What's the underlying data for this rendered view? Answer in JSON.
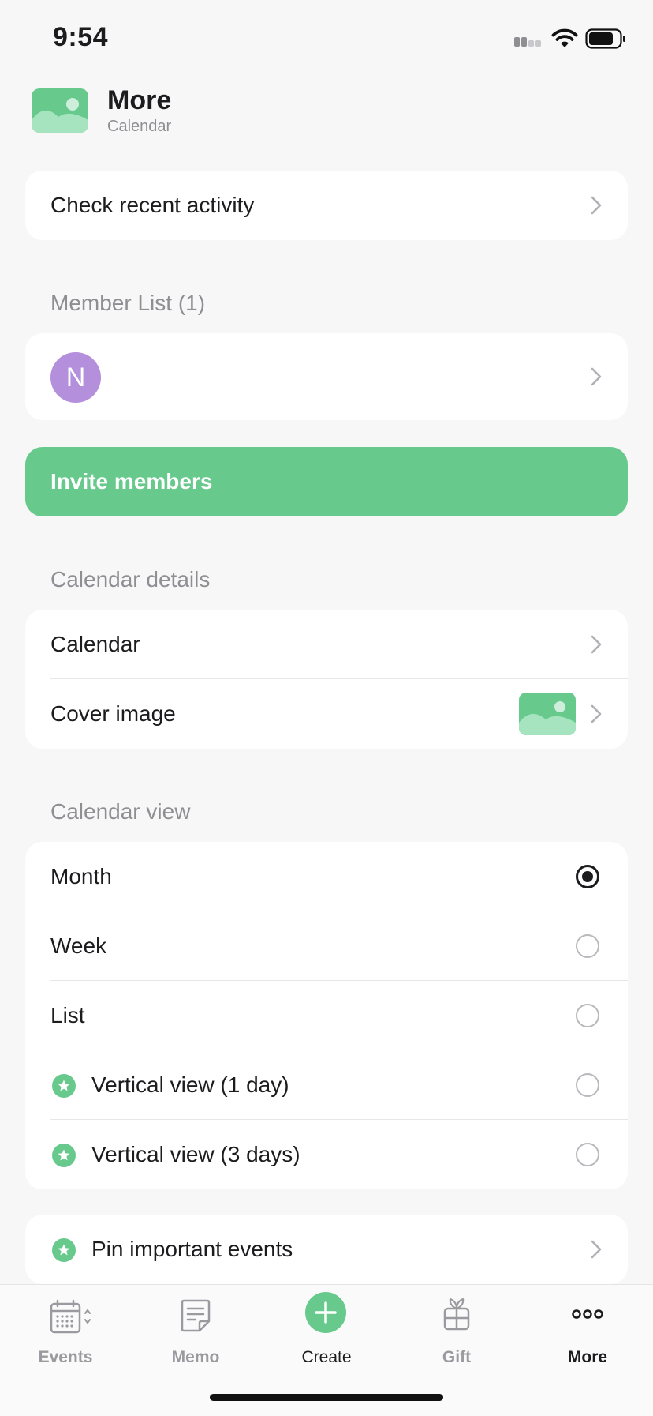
{
  "status_bar": {
    "time": "9:54"
  },
  "header": {
    "title": "More",
    "subtitle": "Calendar"
  },
  "recent_activity": {
    "label": "Check recent activity"
  },
  "members": {
    "section_title": "Member List (1)",
    "items": [
      {
        "initial": "N",
        "color": "#b48fdb"
      }
    ],
    "invite_label": "Invite members"
  },
  "calendar_details": {
    "section_title": "Calendar details",
    "calendar_label": "Calendar",
    "cover_label": "Cover image"
  },
  "calendar_view": {
    "section_title": "Calendar view",
    "options": [
      {
        "label": "Month",
        "selected": true,
        "premium": false
      },
      {
        "label": "Week",
        "selected": false,
        "premium": false
      },
      {
        "label": "List",
        "selected": false,
        "premium": false
      },
      {
        "label": "Vertical view (1 day)",
        "selected": false,
        "premium": true
      },
      {
        "label": "Vertical view (3 days)",
        "selected": false,
        "premium": true
      }
    ]
  },
  "pin_events": {
    "label": "Pin important events",
    "premium": true
  },
  "tab_bar": {
    "tabs": [
      {
        "label": "Events",
        "icon": "calendar-icon"
      },
      {
        "label": "Memo",
        "icon": "memo-icon"
      },
      {
        "label": "Create",
        "icon": "plus-circle-icon"
      },
      {
        "label": "Gift",
        "icon": "gift-icon"
      },
      {
        "label": "More",
        "icon": "more-dots-icon"
      }
    ],
    "active": "More"
  },
  "colors": {
    "accent": "#67c98c",
    "avatar": "#b48fdb",
    "background": "#f7f7f7"
  }
}
